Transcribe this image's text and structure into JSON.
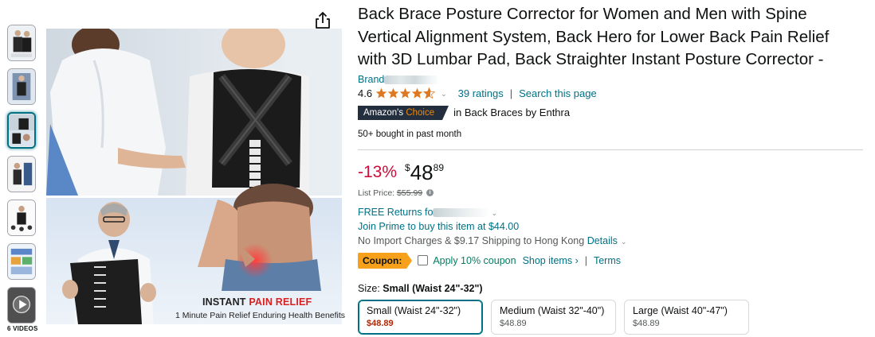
{
  "gallery": {
    "thumbnails": [
      {
        "name": "thumb-1"
      },
      {
        "name": "thumb-2"
      },
      {
        "name": "thumb-3",
        "selected": true
      },
      {
        "name": "thumb-4"
      },
      {
        "name": "thumb-5"
      },
      {
        "name": "thumb-6"
      },
      {
        "name": "thumb-video",
        "video": true
      }
    ],
    "videos_label": "6 VIDEOS",
    "caption_line1_prefix": "INSTANT ",
    "caption_line1_highlight": "PAIN RELIEF",
    "caption_line2": "1 Minute Pain Relief Enduring Health Benefits",
    "share_icon": "share-icon"
  },
  "product": {
    "title_lines": [
      "Back Brace Posture Corrector for Women and Men with Spine",
      "Vertical Alignment System, Back Hero for Lower Back Pain Relief",
      "with 3D Lumbar Pad, Back Straighter Instant Posture Corrector -"
    ],
    "brand_prefix": "Brand",
    "rating": "4.6",
    "stars_value": 4.6,
    "ratings_link": "39 ratings",
    "search_link": "Search this page",
    "badge_part1": "Amazon's ",
    "badge_part2": "Choice",
    "badge_context": "in Back Braces by Enthra",
    "bought": "50+ bought in past month"
  },
  "pricing": {
    "discount": "-13%",
    "currency": "$",
    "whole": "48",
    "fraction": "89",
    "list_price_label": "List Price: ",
    "list_price": "$55.99",
    "free_returns": "FREE Returns fo",
    "prime": "Join Prime to buy this item at $44.00",
    "import_text": "No Import Charges & $9.17 Shipping to Hong Kong ",
    "details_link": "Details",
    "coupon_badge": "Coupon:",
    "coupon_text": "Apply 10% coupon",
    "shop_items": "Shop items ›",
    "terms": "Terms"
  },
  "size": {
    "label": "Size: ",
    "selected": "Small (Waist 24\"-32\")",
    "options": [
      {
        "name": "Small (Waist 24\"-32\")",
        "price": "$48.89",
        "selected": true
      },
      {
        "name": "Medium (Waist 32\"-40\")",
        "price": "$48.89"
      },
      {
        "name": "Large (Waist 40\"-47\")",
        "price": "$48.89"
      }
    ]
  },
  "colors": {
    "link": "#007185",
    "discount": "#cc0c39",
    "star": "#de7921",
    "badge_bg": "#232f3e",
    "coupon_bg": "#f7a01c",
    "coupon_text": "#067d62",
    "selected_price": "#b12704"
  }
}
